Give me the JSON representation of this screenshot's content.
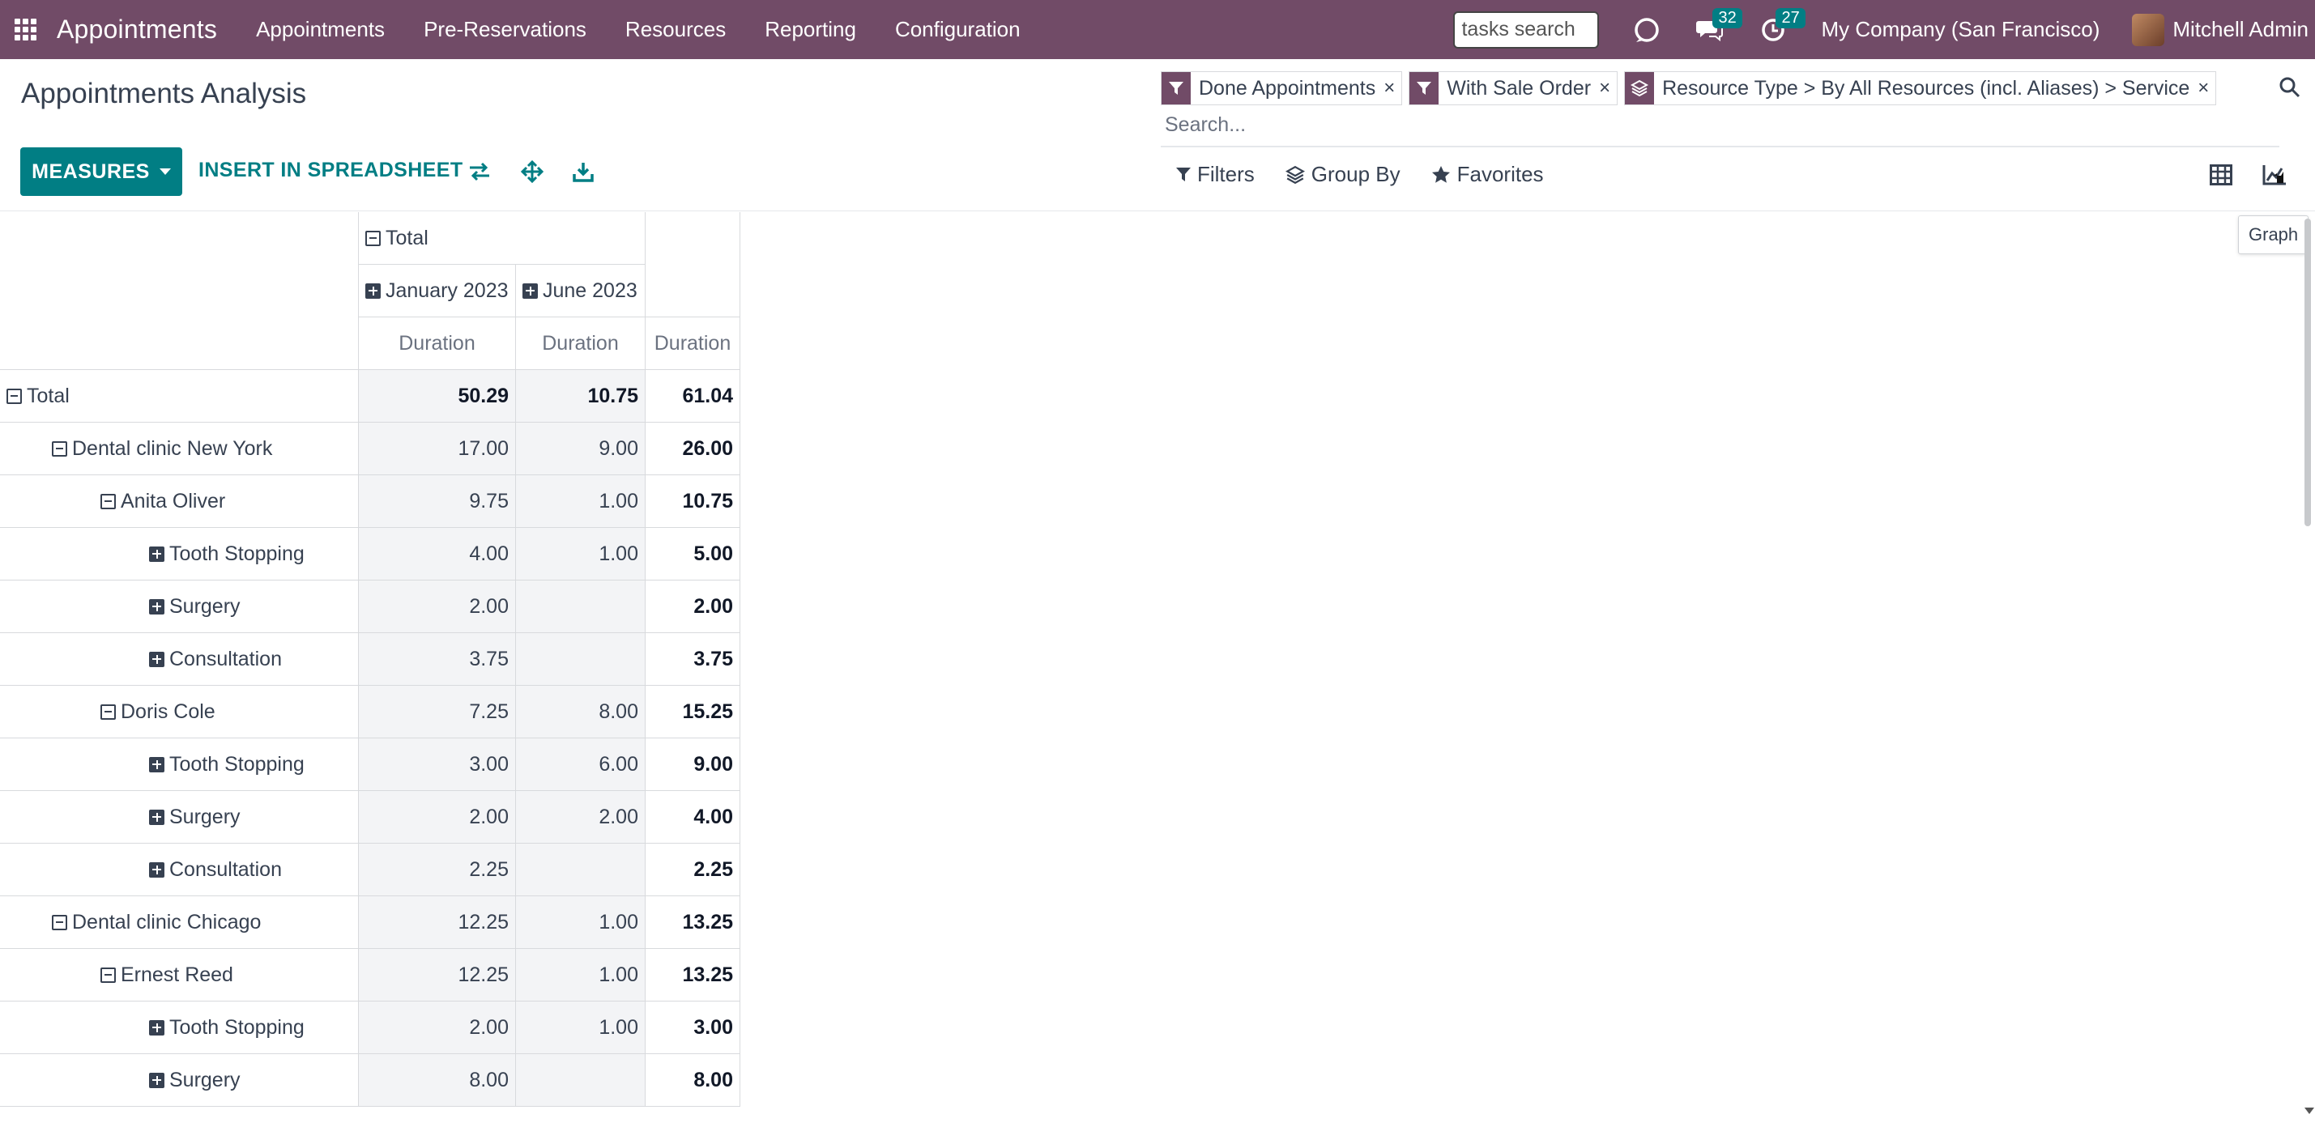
{
  "navbar": {
    "brand": "Appointments",
    "menu": [
      "Appointments",
      "Pre-Reservations",
      "Resources",
      "Reporting",
      "Configuration"
    ],
    "search_value": "tasks search",
    "messages_count": "32",
    "activities_count": "27",
    "company": "My Company (San Francisco)",
    "user": "Mitchell Admin"
  },
  "control_panel": {
    "title": "Appointments Analysis",
    "measures_label": "MEASURES",
    "insert_label": "INSERT IN SPREADSHEET",
    "facets": [
      {
        "icon": "filter-icon",
        "label": "Done Appointments"
      },
      {
        "icon": "filter-icon",
        "label": "With Sale Order"
      },
      {
        "icon": "layers-icon",
        "label": "Resource Type > By All Resources (incl. Aliases) > Service"
      }
    ],
    "search_placeholder": "Search...",
    "filters_label": "Filters",
    "groupby_label": "Group By",
    "favorites_label": "Favorites",
    "tooltip": "Graph",
    "accent_color": "#714B67",
    "button_color": "#017e84"
  },
  "pivot": {
    "col_total": "Total",
    "col_groups": [
      "January 2023",
      "June 2023"
    ],
    "measure": "Duration",
    "rows": [
      {
        "label": "Total",
        "sign": "minus",
        "level": 0,
        "values": [
          "50.29",
          "10.75",
          "61.04"
        ]
      },
      {
        "label": "Dental clinic New York",
        "sign": "minus",
        "level": 1,
        "values": [
          "17.00",
          "9.00",
          "26.00"
        ]
      },
      {
        "label": "Anita Oliver",
        "sign": "minus",
        "level": 2,
        "values": [
          "9.75",
          "1.00",
          "10.75"
        ]
      },
      {
        "label": "Tooth Stopping",
        "sign": "plus",
        "level": 3,
        "values": [
          "4.00",
          "1.00",
          "5.00"
        ]
      },
      {
        "label": "Surgery",
        "sign": "plus",
        "level": 3,
        "values": [
          "2.00",
          "",
          "2.00"
        ]
      },
      {
        "label": "Consultation",
        "sign": "plus",
        "level": 3,
        "values": [
          "3.75",
          "",
          "3.75"
        ]
      },
      {
        "label": "Doris Cole",
        "sign": "minus",
        "level": 2,
        "values": [
          "7.25",
          "8.00",
          "15.25"
        ]
      },
      {
        "label": "Tooth Stopping",
        "sign": "plus",
        "level": 3,
        "values": [
          "3.00",
          "6.00",
          "9.00"
        ]
      },
      {
        "label": "Surgery",
        "sign": "plus",
        "level": 3,
        "values": [
          "2.00",
          "2.00",
          "4.00"
        ]
      },
      {
        "label": "Consultation",
        "sign": "plus",
        "level": 3,
        "values": [
          "2.25",
          "",
          "2.25"
        ]
      },
      {
        "label": "Dental clinic Chicago",
        "sign": "minus",
        "level": 1,
        "values": [
          "12.25",
          "1.00",
          "13.25"
        ]
      },
      {
        "label": "Ernest Reed",
        "sign": "minus",
        "level": 2,
        "values": [
          "12.25",
          "1.00",
          "13.25"
        ]
      },
      {
        "label": "Tooth Stopping",
        "sign": "plus",
        "level": 3,
        "values": [
          "2.00",
          "1.00",
          "3.00"
        ]
      },
      {
        "label": "Surgery",
        "sign": "plus",
        "level": 3,
        "values": [
          "8.00",
          "",
          "8.00"
        ]
      }
    ]
  }
}
